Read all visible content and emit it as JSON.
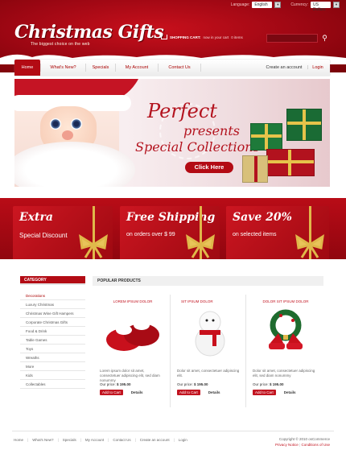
{
  "topbar": {
    "language_label": "Language:",
    "language": "English",
    "currency_label": "Currency:",
    "currency": "US Dollars"
  },
  "logo": {
    "title": "Christmas Gifts",
    "tagline": "The biggest choice on the web"
  },
  "cart": {
    "label": "SHOPPING CART:",
    "text": "now in your cart",
    "count": "0 items"
  },
  "nav": {
    "items": [
      "Home",
      "What's New?",
      "Specials",
      "My Account",
      "Contact Us"
    ],
    "create_account": "Create an account",
    "login": "Login"
  },
  "banner": {
    "line1": "Perfect",
    "line2": "presents",
    "line3": "Special Collections",
    "button": "Click Here"
  },
  "promos": [
    {
      "title": "Extra",
      "subtitle": "Special Discount"
    },
    {
      "title": "Free Shipping",
      "subtitle": "on orders over $ 99"
    },
    {
      "title": "Save 20%",
      "subtitle": "on selected items"
    }
  ],
  "category": {
    "heading": "CATEGORY",
    "items": [
      "Decorations",
      "Luxury Christmas",
      "Christmas Wine Gift Hampers",
      "Corporate Christmas Gifts",
      "Food & Drink",
      "Table Games",
      "Toys",
      "Wreaths",
      "More",
      "Kids",
      "Collectables"
    ]
  },
  "popular": {
    "heading": "POPULAR PRODUCTS"
  },
  "products": [
    {
      "name": "LOREM IPSUM DOLOR",
      "desc": "Lorem ipsum dolor sit amet, consectetuer adipiscing elit, sed diam nonummy",
      "price_label": "Our price:",
      "price": "$ 195.00",
      "cart": "Add to Cart",
      "details": "Details"
    },
    {
      "name": "SIT IPSUM DOLOR",
      "desc": "Dolor sit amet, consectetuer adipiscing elit.",
      "price_label": "Our price:",
      "price": "$ 195.00",
      "cart": "Add to Cart",
      "details": "Details"
    },
    {
      "name": "DOLOR SIT IPSUM DOLOR",
      "desc": "Dolor sit amet, consectetuer adipiscing elit, sed diam nonummy",
      "price_label": "Our price:",
      "price": "$ 195.00",
      "cart": "Add to Cart",
      "details": "Details"
    }
  ],
  "footer": {
    "links": [
      "Home",
      "What's New?",
      "Specials",
      "My Account",
      "Contact Us",
      "Create an account",
      "Login"
    ],
    "copyright": "Copyright © 2010 osCommerce",
    "privacy": "Privacy Notice",
    "conditions": "Conditions of Use"
  }
}
